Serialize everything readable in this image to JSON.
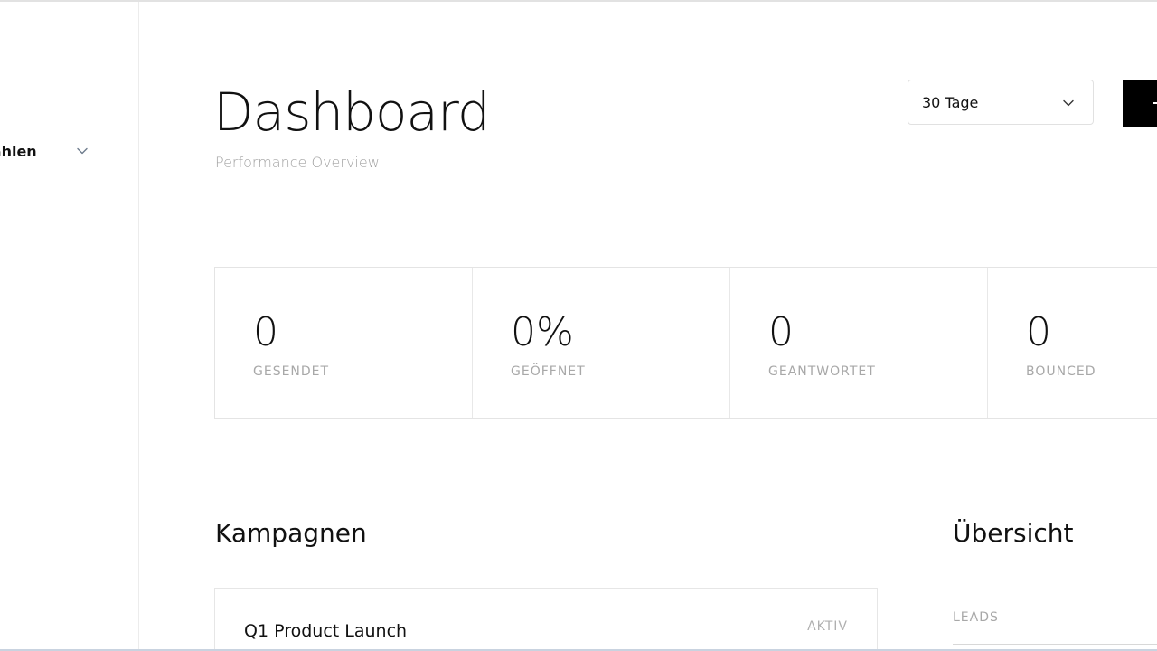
{
  "sidebar": {
    "workspace_select_label": "wählen"
  },
  "header": {
    "title": "Dashboard",
    "subtitle": "Performance Overview",
    "range_select_value": "30 Tage"
  },
  "stats": [
    {
      "value": "0",
      "label": "GESENDET"
    },
    {
      "value": "0%",
      "label": "GEÖFFNET"
    },
    {
      "value": "0",
      "label": "GEANTWORTET"
    },
    {
      "value": "0",
      "label": "BOUNCED"
    }
  ],
  "campaigns": {
    "heading": "Kampagnen",
    "items": [
      {
        "name": "Q1 Product Launch",
        "status": "AKTIV"
      }
    ]
  },
  "overview": {
    "heading": "Übersicht",
    "metrics": [
      {
        "label": "LEADS"
      }
    ]
  },
  "icons": {
    "workspace_chevron": "chevron-down-icon",
    "range_chevron": "chevron-down-icon",
    "primary_action": "plus-icon"
  },
  "colors": {
    "primary_button": "#000000",
    "muted_text": "#a8a8a8",
    "border": "#e4e4e4"
  }
}
